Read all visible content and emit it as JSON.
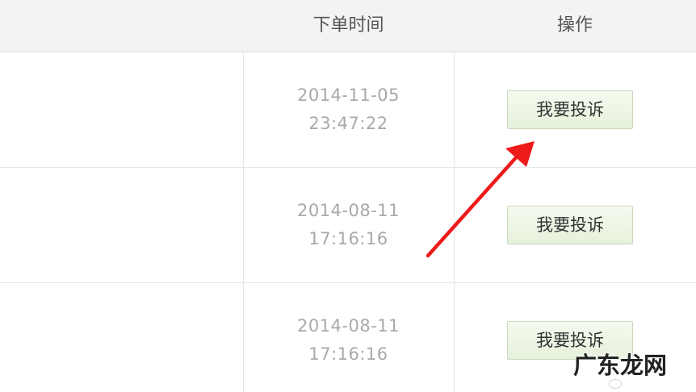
{
  "table": {
    "headers": {
      "order_time": "下单时间",
      "action": "操作"
    },
    "rows": [
      {
        "date": "2014-11-05",
        "time": "23:47:22",
        "button": "我要投诉"
      },
      {
        "date": "2014-08-11",
        "time": "17:16:16",
        "button": "我要投诉"
      },
      {
        "date": "2014-08-11",
        "time": "17:16:16",
        "button": "我要投诉"
      }
    ]
  },
  "annotation": {
    "arrow_color": "#ee1b1b"
  },
  "watermark": {
    "text": "广东龙网"
  }
}
